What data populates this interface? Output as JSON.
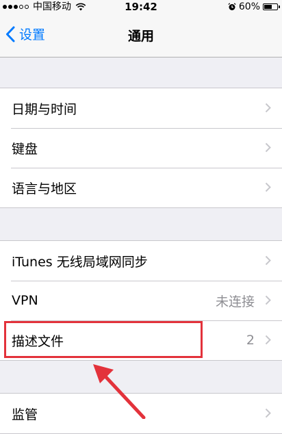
{
  "status_bar": {
    "carrier": "中国移动",
    "time": "19:42",
    "battery_percent": "60%",
    "battery_level": 0.6,
    "signal_icon": "signal-dots-icon",
    "wifi_icon": "wifi-icon",
    "alarm_icon": "alarm-clock-icon"
  },
  "nav": {
    "back_label": "设置",
    "title": "通用"
  },
  "groups": [
    {
      "rows": [
        {
          "label": "日期与时间",
          "value": ""
        },
        {
          "label": "键盘",
          "value": ""
        },
        {
          "label": "语言与地区",
          "value": ""
        }
      ]
    },
    {
      "rows": [
        {
          "label": "iTunes 无线局域网同步",
          "value": ""
        },
        {
          "label": "VPN",
          "value": "未连接"
        },
        {
          "label": "描述文件",
          "value": "2"
        }
      ]
    },
    {
      "rows": [
        {
          "label": "监管",
          "value": ""
        }
      ]
    }
  ],
  "colors": {
    "accent": "#007aff",
    "annotation": "#e3323b",
    "background": "#efeff4",
    "secondary_text": "#8e8e93"
  }
}
